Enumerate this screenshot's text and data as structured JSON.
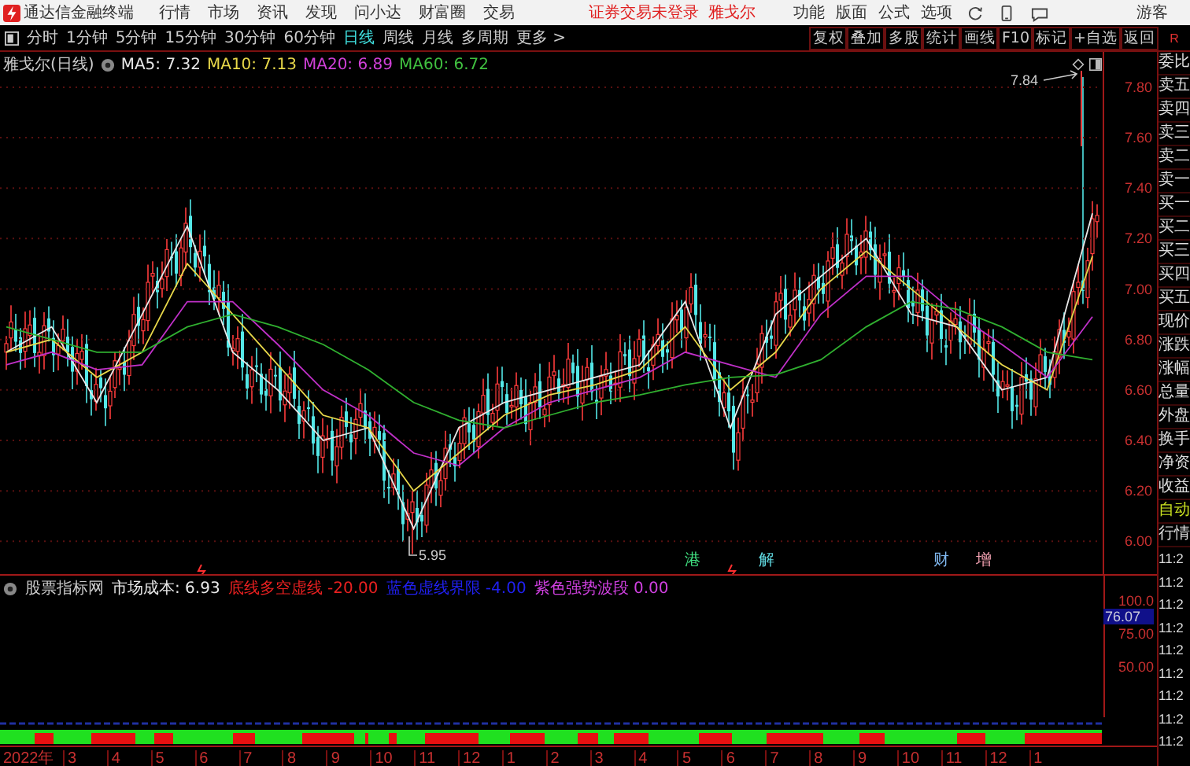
{
  "menu_bar": {
    "app_title": "通达信金融终端",
    "menus": [
      "行情",
      "市场",
      "资讯",
      "发现",
      "问小达",
      "财富圈",
      "交易"
    ],
    "login_status": "证券交易未登录",
    "stock_name": "雅戈尔",
    "tools": [
      "功能",
      "版面",
      "公式",
      "选项"
    ],
    "user": "游客"
  },
  "toolbar": {
    "periods": [
      {
        "label": "分时",
        "selected": false
      },
      {
        "label": "1分钟",
        "selected": false
      },
      {
        "label": "5分钟",
        "selected": false
      },
      {
        "label": "15分钟",
        "selected": false
      },
      {
        "label": "30分钟",
        "selected": false
      },
      {
        "label": "60分钟",
        "selected": false
      },
      {
        "label": "日线",
        "selected": true
      },
      {
        "label": "周线",
        "selected": false
      },
      {
        "label": "月线",
        "selected": false
      },
      {
        "label": "多周期",
        "selected": false
      },
      {
        "label": "更多 >",
        "selected": false
      }
    ],
    "buttons": [
      "复权",
      "叠加",
      "多股",
      "统计",
      "画线",
      "F10",
      "标记",
      "+自选",
      "返回"
    ]
  },
  "chart_header": {
    "title": "雅戈尔(日线)",
    "indicators": [
      {
        "label": "MA5: 7.32",
        "color": "#e8e8e8"
      },
      {
        "label": "MA10: 7.13",
        "color": "#e8d84a"
      },
      {
        "label": "MA20: 6.89",
        "color": "#d040d8"
      },
      {
        "label": "MA60: 6.72",
        "color": "#40c040"
      }
    ]
  },
  "price_chart": {
    "chart_data": {
      "type": "line",
      "grid": true,
      "ylim": [
        5.87,
        7.94
      ],
      "yticks": [
        {
          "value": 7.8,
          "label": "7.80"
        },
        {
          "value": 7.6,
          "label": "7.60"
        },
        {
          "value": 7.4,
          "label": "7.40"
        },
        {
          "value": 7.2,
          "label": "7.20"
        },
        {
          "value": 7.0,
          "label": "7.00"
        },
        {
          "value": 6.8,
          "label": "6.80"
        },
        {
          "value": 6.6,
          "label": "6.60"
        },
        {
          "value": 6.4,
          "label": "6.40"
        },
        {
          "value": 6.2,
          "label": "6.20"
        },
        {
          "value": 6.0,
          "label": "6.00"
        }
      ],
      "series": [
        {
          "color": "#e8e8e8",
          "values": [
            6.75,
            6.85,
            6.55,
            6.9,
            7.25,
            6.75,
            6.6,
            6.4,
            6.45,
            6.05,
            6.45,
            6.55,
            6.6,
            6.65,
            6.7,
            6.95,
            6.45,
            6.9,
            7.05,
            7.2,
            6.9,
            6.85,
            6.6,
            6.65,
            7.3
          ]
        },
        {
          "color": "#e8d84a",
          "values": [
            6.75,
            6.8,
            6.65,
            6.75,
            7.1,
            6.9,
            6.7,
            6.5,
            6.45,
            6.2,
            6.35,
            6.5,
            6.58,
            6.62,
            6.68,
            6.85,
            6.6,
            6.75,
            7.0,
            7.15,
            7.0,
            6.85,
            6.7,
            6.6,
            7.13
          ]
        },
        {
          "color": "#c030c8",
          "values": [
            6.7,
            6.75,
            6.68,
            6.7,
            6.95,
            6.95,
            6.78,
            6.6,
            6.5,
            6.35,
            6.3,
            6.45,
            6.55,
            6.6,
            6.65,
            6.75,
            6.7,
            6.65,
            6.9,
            7.05,
            7.05,
            6.9,
            6.78,
            6.65,
            6.89
          ]
        },
        {
          "color": "#30b030",
          "values": [
            6.85,
            6.8,
            6.75,
            6.75,
            6.85,
            6.9,
            6.85,
            6.78,
            6.68,
            6.55,
            6.48,
            6.45,
            6.5,
            6.55,
            6.58,
            6.62,
            6.65,
            6.66,
            6.72,
            6.85,
            6.95,
            6.92,
            6.85,
            6.75,
            6.72
          ]
        }
      ]
    }
  },
  "annotations": {
    "high": "7.84",
    "low": "5.95"
  },
  "event_markers": [
    {
      "label": "港",
      "color": "#40e080"
    },
    {
      "label": "解",
      "color": "#60d8e0"
    },
    {
      "label": "财",
      "color": "#80b8f0"
    },
    {
      "label": "增",
      "color": "#f0a0b0"
    }
  ],
  "indicator_header": {
    "name": "股票指标网",
    "items": [
      {
        "label": "市场成本: 6.93",
        "color": "#e8e8e8"
      },
      {
        "label": "底线多空虚线 -20.00",
        "color": "#e82020"
      },
      {
        "label": "蓝色虚线界限 -4.00",
        "color": "#2020f0"
      },
      {
        "label": "紫色强势波段 0.00",
        "color": "#d040e0"
      }
    ]
  },
  "indicator_axis": [
    "100.0",
    "75.00",
    "50.00"
  ],
  "indicator_reading": "76.07",
  "date_axis": [
    "2022年",
    "3",
    "4",
    "5",
    "6",
    "7",
    "8",
    "9",
    "10",
    "11",
    "12",
    "1",
    "2",
    "3",
    "4",
    "5",
    "6",
    "7",
    "8",
    "9",
    "10",
    "11",
    "12",
    "1"
  ],
  "quote_panel": {
    "header": "R",
    "labels": [
      {
        "label": "委比",
        "kind": "plain"
      },
      {
        "label": "卖五",
        "kind": "plain"
      },
      {
        "label": "卖四",
        "kind": "plain"
      },
      {
        "label": "卖三",
        "kind": "plain"
      },
      {
        "label": "卖二",
        "kind": "plain"
      },
      {
        "label": "卖一",
        "kind": "plain"
      },
      {
        "label": "买一",
        "kind": "plain"
      },
      {
        "label": "买二",
        "kind": "plain"
      },
      {
        "label": "买三",
        "kind": "plain"
      },
      {
        "label": "买四",
        "kind": "plain"
      },
      {
        "label": "买五",
        "kind": "plain"
      },
      {
        "label": "现价",
        "kind": "plain"
      },
      {
        "label": "涨跌",
        "kind": "plain"
      },
      {
        "label": "涨幅",
        "kind": "plain"
      },
      {
        "label": "总量",
        "kind": "plain"
      },
      {
        "label": "外盘",
        "kind": "plain"
      },
      {
        "label": "换手",
        "kind": "plain"
      },
      {
        "label": "净资",
        "kind": "plain"
      },
      {
        "label": "收益",
        "kind": "plain"
      },
      {
        "label": "自动",
        "kind": "highlight"
      },
      {
        "label": "行情",
        "kind": "plain"
      }
    ],
    "times": [
      "11:2",
      "11:2",
      "11:2",
      "11:2",
      "11:2",
      "11:2",
      "11:2",
      "11:2",
      "11:2"
    ]
  }
}
